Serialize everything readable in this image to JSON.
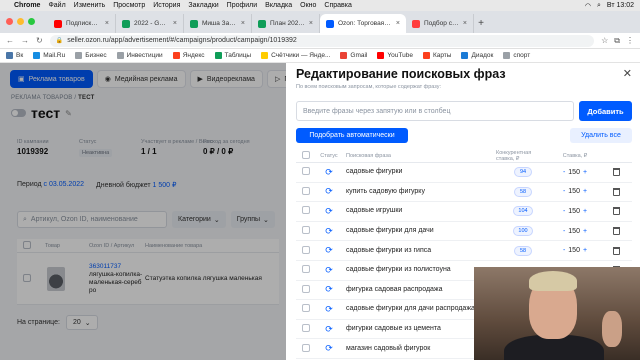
{
  "menubar": {
    "app": "Chrome",
    "items": [
      "Файл",
      "Изменить",
      "Просмотр",
      "История",
      "Закладки",
      "Профили",
      "Вкладка",
      "Окно",
      "Справка"
    ],
    "clock": "Вт 13:02"
  },
  "tabs": [
    {
      "title": "Подписки - YouTube",
      "color": "#ff0000"
    },
    {
      "title": "2022 - Google Таблицы",
      "color": "#0f9d58"
    },
    {
      "title": "Миша Заказы - Google",
      "color": "#0f9d58"
    },
    {
      "title": "План 2021 - Google Та...",
      "color": "#0f9d58"
    },
    {
      "title": "Ozon: Торговая площад...",
      "color": "#005bff",
      "active": true
    },
    {
      "title": "Подбор слов",
      "color": "#ff3d3d"
    }
  ],
  "address": {
    "url": "seller.ozon.ru/app/advertisement/#/campaigns/product/campaign/1019392"
  },
  "bookmarks": [
    "Вк",
    "Mail.Ru",
    "Бизнес",
    "Инвестиции",
    "Яндекс",
    "Таблицы",
    "Счётчики — Янде...",
    "Gmail",
    "YouTube",
    "Карты",
    "Диадок",
    "спорт"
  ],
  "page": {
    "campaign_tabs": [
      {
        "label": "Реклама товаров",
        "icon": "megaphone-icon"
      },
      {
        "label": "Медийная реклама",
        "icon": "eye-icon"
      },
      {
        "label": "Видеореклама",
        "icon": "video-icon"
      },
      {
        "label": "Пр",
        "icon": "play-icon"
      }
    ],
    "breadcrumb": {
      "root": "РЕКЛАМА ТОВАРОВ",
      "sep": " / ",
      "current": "ТЕСТ"
    },
    "campaign_name": "тест",
    "info": [
      {
        "label": "ID кампании",
        "value": "1019392"
      },
      {
        "label": "Статус",
        "value": "Неактивна"
      },
      {
        "label": "Участвует в рекламе / Всего",
        "value": "1 / 1"
      },
      {
        "label": "Расход за сегодня",
        "value": "0 ₽ / 0 ₽"
      }
    ],
    "period_label": "Период",
    "period_value": "с 03.05.2022",
    "budget_label": "Дневной бюджет",
    "budget_value": "1 500 ₽",
    "search_placeholder": "Артикул, Ozon ID, наименование",
    "dd_categories": "Категории",
    "dd_groups": "Группы",
    "table_head": {
      "product": "Товар",
      "ozon_id": "Ozon ID / Артикул",
      "name": "Наименование товара"
    },
    "product": {
      "id": "363011737",
      "desc": "лягушка-копилка-маленькая-серебро",
      "name": "Статуэтка копилка лягушка маленькая"
    },
    "per_page_label": "На странице:",
    "per_page_value": "20"
  },
  "modal": {
    "title": "Редактирование поисковых фраз",
    "hint": "По всем поисковым запросам, которые содержат фразу:",
    "input_placeholder": "Введите фразы через запятую или в столбец",
    "add_button": "Добавить",
    "auto_button": "Подобрать автоматически",
    "delete_all_button": "Удалить все",
    "columns": {
      "status": "Статус",
      "phrase": "Поисковая фраза",
      "bid": "Конкурентная ставка, ₽",
      "rate": "Ставка, ₽"
    },
    "rows": [
      {
        "phrase": "садовые фигурки",
        "bid": "94",
        "rate": "150"
      },
      {
        "phrase": "купить садовую фигурку",
        "bid": "58",
        "rate": "150"
      },
      {
        "phrase": "садовые игрушки",
        "bid": "104",
        "rate": "150"
      },
      {
        "phrase": "садовые фигурки для дачи",
        "bid": "100",
        "rate": "150"
      },
      {
        "phrase": "садовые фигурки из гипса",
        "bid": "58",
        "rate": "150"
      },
      {
        "phrase": "садовые фигурки из полистоуна",
        "bid": "",
        "rate": ""
      },
      {
        "phrase": "фигурка садовая распродажа",
        "bid": "",
        "rate": ""
      },
      {
        "phrase": "садовые фигурки для дачи распродажа",
        "bid": "",
        "rate": ""
      },
      {
        "phrase": "фигурки садовые из цемента",
        "bid": "",
        "rate": ""
      },
      {
        "phrase": "магазин садовый фигурок",
        "bid": "",
        "rate": ""
      }
    ]
  }
}
